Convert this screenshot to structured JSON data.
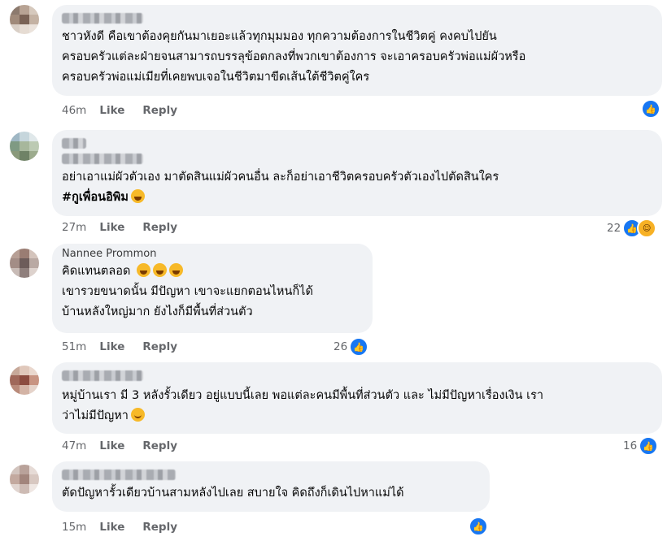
{
  "ui": {
    "like_label": "Like",
    "reply_label": "Reply",
    "accent": "#1877f2",
    "bubble_bg": "#f0f2f5"
  },
  "comments": [
    {
      "author": "",
      "lines": [
        "ชาวหังดี คือเขาต้องคุยกันมาเยอะแล้วทุกมุมมอง ทุกความต้องการในชีวิตคู่ คงคบไปยัน",
        "ครอบครัวแต่ละฝ่ายจนสามารถบรรลุข้อตกลงที่พวกเขาต้องการ จะเอาครอบครัวพ่อแม่ผัวหรือ",
        "ครอบครัวพ่อแม่เมียที่เคยพบเจอในชีวิตมาขีดเส้นใต้ชีวิตคู่ใคร"
      ],
      "time": "46m",
      "reaction_count": "",
      "reactions": [
        "like"
      ]
    },
    {
      "author": "",
      "lines": [
        "อย่าเอาแม่ผัวตัวเอง มาตัดสินแม่ผัวคนอื่น ละก็อย่าเอาชีวิตครอบครัวตัวเองไปตัดสินใคร",
        "#กูเพื่อนอิพิม"
      ],
      "time": "27m",
      "reaction_count": "22",
      "reactions": [
        "like",
        "haha"
      ]
    },
    {
      "author": "Nannee Prommon",
      "lines": [
        "คิดแทนตลอด",
        "เขารวยขนาดนั้น มีปัญหา เขาจะแยกตอนไหนก็ได้",
        "บ้านหลังใหญ่มาก ยังไงก็มีพื้นที่ส่วนตัว"
      ],
      "time": "51m",
      "reaction_count": "26",
      "reactions": [
        "like"
      ]
    },
    {
      "author": "",
      "lines": [
        "หมู่บ้านเรา มี 3 หลังรั้วเดียว อยู่แบบนี้เลย พอแต่ละคนมีพื้นที่ส่วนตัว และ ไม่มีปัญหาเรื่องเงิน เรา",
        "ว่าไม่มีปัญหา"
      ],
      "time": "47m",
      "reaction_count": "16",
      "reactions": [
        "like"
      ]
    },
    {
      "author": "",
      "lines": [
        "ตัดปัญหารั้วเดียวบ้านสามหลังไปเลย สบายใจ คิดถึงก็เดินไปหาแม่ได้"
      ],
      "time": "15m",
      "reaction_count": "",
      "reactions": [
        "like"
      ]
    }
  ]
}
